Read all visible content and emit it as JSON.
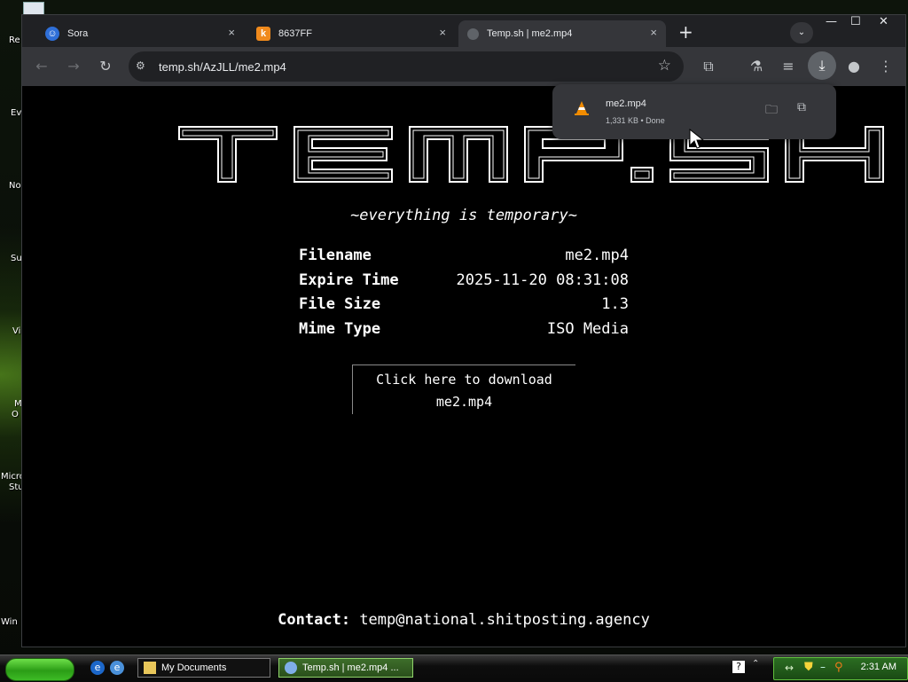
{
  "desktop": {
    "labels": [
      "Re",
      "Ev",
      "No",
      "Su",
      "Vi",
      "M",
      "O",
      "Micro",
      "Stu",
      "Win"
    ]
  },
  "tabs": [
    {
      "label": "Sora",
      "close": "×"
    },
    {
      "label": "8637FF",
      "close": "×"
    },
    {
      "label": "Temp.sh | me2.mp4",
      "close": "×"
    }
  ],
  "new_tab_label": "+",
  "window_controls": {
    "minimize": "—",
    "maximize": "☐",
    "close": "✕"
  },
  "omnibox": {
    "url": "temp.sh/AzJLL/me2.mp4"
  },
  "download_bubble": {
    "filename": "me2.mp4",
    "meta": "1,331 KB • Done"
  },
  "page": {
    "logo": "TEMP.SH",
    "tagline": "~everything is temporary~",
    "info": [
      {
        "key": "Filename",
        "value": "me2.mp4"
      },
      {
        "key": "Expire Time",
        "value": "2025-11-20 08:31:08"
      },
      {
        "key": "File Size",
        "value": "1.3"
      },
      {
        "key": "Mime Type",
        "value": "ISO Media"
      }
    ],
    "download_line1": "Click here to download",
    "download_line2": "me2.mp4",
    "contact_label": "Contact:",
    "contact_email": "temp@national.shitposting.agency"
  },
  "taskbar": {
    "items": [
      {
        "label": "My Documents"
      },
      {
        "label": "Temp.sh | me2.mp4 ..."
      }
    ],
    "clock": "2:31 AM"
  },
  "colors": {
    "tab_strip": "#202124",
    "toolbar": "#35363a",
    "page_bg": "#000000",
    "text": "#ffffff",
    "taskbar_green": "#2b9d16"
  }
}
